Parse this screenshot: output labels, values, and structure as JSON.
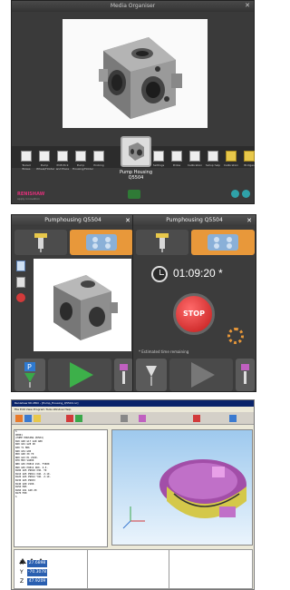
{
  "media_organizer": {
    "title": "Media Organiser",
    "close": "✕",
    "selected_item": "Pump Housing\nQ5504",
    "brand": "RENISHAW",
    "tagline": "apply innovation",
    "thumbs": [
      {
        "label": "Tooled Boxes",
        "color": "#eeeeee"
      },
      {
        "label": "Pump Wheel/Holder",
        "color": "#eeeeee"
      },
      {
        "label": "PCB Pick and Place",
        "color": "#eeeeee"
      },
      {
        "label": "Pump Housing/Holder",
        "color": "#eeeeee"
      },
      {
        "label": "Probing",
        "color": "#eeeeee"
      },
      {
        "label": "Settings",
        "color": "#eeeeee"
      },
      {
        "label": "Probe",
        "color": "#eeeeee"
      },
      {
        "label": "Calibration",
        "color": "#eeeeee"
      },
      {
        "label": "Setup help",
        "color": "#eeeeee"
      },
      {
        "label": "Calibration",
        "color": "#e8c84a"
      },
      {
        "label": "Bridges",
        "color": "#e8c84a"
      },
      {
        "label": "Misc",
        "color": "#e8c84a"
      }
    ]
  },
  "panel_program": {
    "title": "Pumphousing Q5504",
    "close": "✕"
  },
  "panel_running": {
    "title": "Pumphousing Q5504",
    "close": "✕",
    "time": "01:09:20 *",
    "stop_label": "STOP",
    "note": "* Estimated time remaining"
  },
  "cam": {
    "window_title": "Renishaw NC-PRO - [Pump_Housing_Q5504.nc]",
    "menu": "File  Edit  View  Program  Tools  Window  Help",
    "code_lines": [
      "%",
      "O0001",
      "(PUMP HOUSING Q5504)",
      "N10 G90 G17 G40 G80",
      "N20 G91 G28 Z0",
      "N30 T1 M06",
      "N40 G54 G90",
      "N50 G00 X0 Y0",
      "N60 G43 H1 Z100.",
      "N70 M03 S4000",
      "N80 G65 P9810 Z10. F3000",
      "N90 G65 P9814 D60. Z-5.",
      "N100 G65 P9810 X30. Y0",
      "N110 G65 P9811 X40. Z-10.",
      "N120 G65 P9812 Y40. Z-10.",
      "N130 G65 P9833",
      "N140 G00 Z100.",
      "N150 M05",
      "N160 G91 G28 Z0",
      "N170 M30",
      "%"
    ],
    "dro": [
      {
        "axis": "X",
        "value": "27.6898"
      },
      {
        "axis": "Y",
        "value": "-70.3078"
      },
      {
        "axis": "Z",
        "value": "47.9209"
      }
    ]
  }
}
